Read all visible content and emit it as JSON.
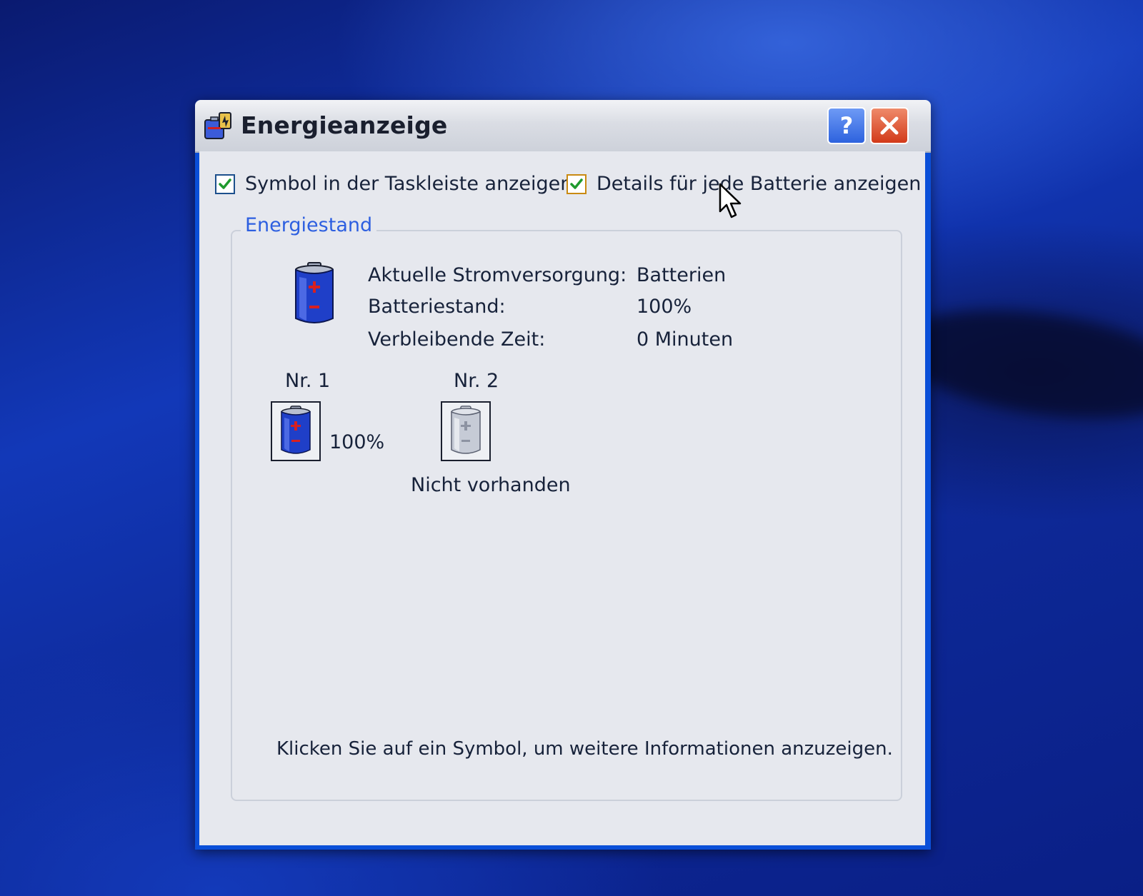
{
  "window": {
    "title": "Energieanzeige",
    "help_label": "?",
    "close_label": "✕"
  },
  "options": {
    "show_taskbar_icon": {
      "label": "Symbol in der Taskleiste anzeigen",
      "checked": true
    },
    "show_battery_details": {
      "label": "Details für jede Batterie anzeigen",
      "checked": true
    }
  },
  "group": {
    "title": "Energiestand",
    "rows": [
      {
        "label": "Aktuelle Stromversorgung:",
        "value": "Batterien"
      },
      {
        "label": "Batteriestand:",
        "value": "100%"
      },
      {
        "label": "Verbleibende Zeit:",
        "value": "0 Minuten"
      }
    ],
    "batteries": [
      {
        "name": "Nr. 1",
        "status": "100%",
        "level": 1.0
      },
      {
        "name": "Nr. 2",
        "status": "Nicht vorhanden"
      }
    ],
    "hint": "Klicken Sie auf ein Symbol, um weitere Informationen anzuzeigen."
  },
  "icons": {
    "app": "power-meter-icon",
    "battery_full": "battery-full-icon",
    "battery_missing": "battery-missing-icon",
    "cursor": "mouse-pointer-icon"
  },
  "colors": {
    "title_bar": "#dadde4",
    "group_title": "#2d5fe0",
    "battery_blue": "#1f3fc8",
    "close_red": "#d23a1a",
    "help_blue": "#2d62de"
  }
}
